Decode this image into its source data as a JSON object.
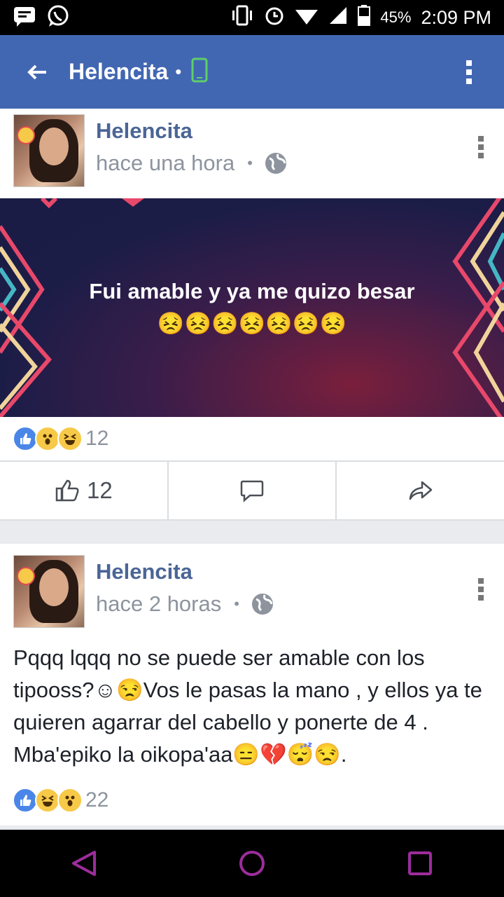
{
  "status_bar": {
    "battery_pct": "45%",
    "time": "2:09 PM"
  },
  "app_bar": {
    "title": "Helencita",
    "separator": "•"
  },
  "posts": [
    {
      "author": "Helencita",
      "time": "hace una hora",
      "separator": "•",
      "banner_text": "Fui amable y ya me quizo besar😣😣😣😣😣😣😣",
      "reactions": [
        "like",
        "wow",
        "haha"
      ],
      "reaction_count": "12",
      "like_count": "12"
    },
    {
      "author": "Helencita",
      "time": "hace 2 horas",
      "separator": "•",
      "text": "Pqqq lqqq no se puede ser amable con los tipooss?☺😒Vos le pasas la mano , y ellos ya te quieren agarrar del cabello y ponerte de 4 . Mba'epiko la oikopa'aa😑💔😴😒.",
      "reactions": [
        "like",
        "haha",
        "wow"
      ],
      "reaction_count": "22"
    }
  ],
  "icons": {
    "status_left": [
      "message-icon",
      "whatsapp-icon"
    ],
    "status_right": [
      "vibrate-icon",
      "alarm-icon",
      "wifi-icon",
      "signal-icon",
      "battery-icon"
    ],
    "nav": [
      "back-nav-icon",
      "home-nav-icon",
      "recents-nav-icon"
    ]
  },
  "colors": {
    "brand_blue": "#4267b2",
    "nav_accent": "#9c2d9c",
    "text_grey": "#8d949e"
  }
}
